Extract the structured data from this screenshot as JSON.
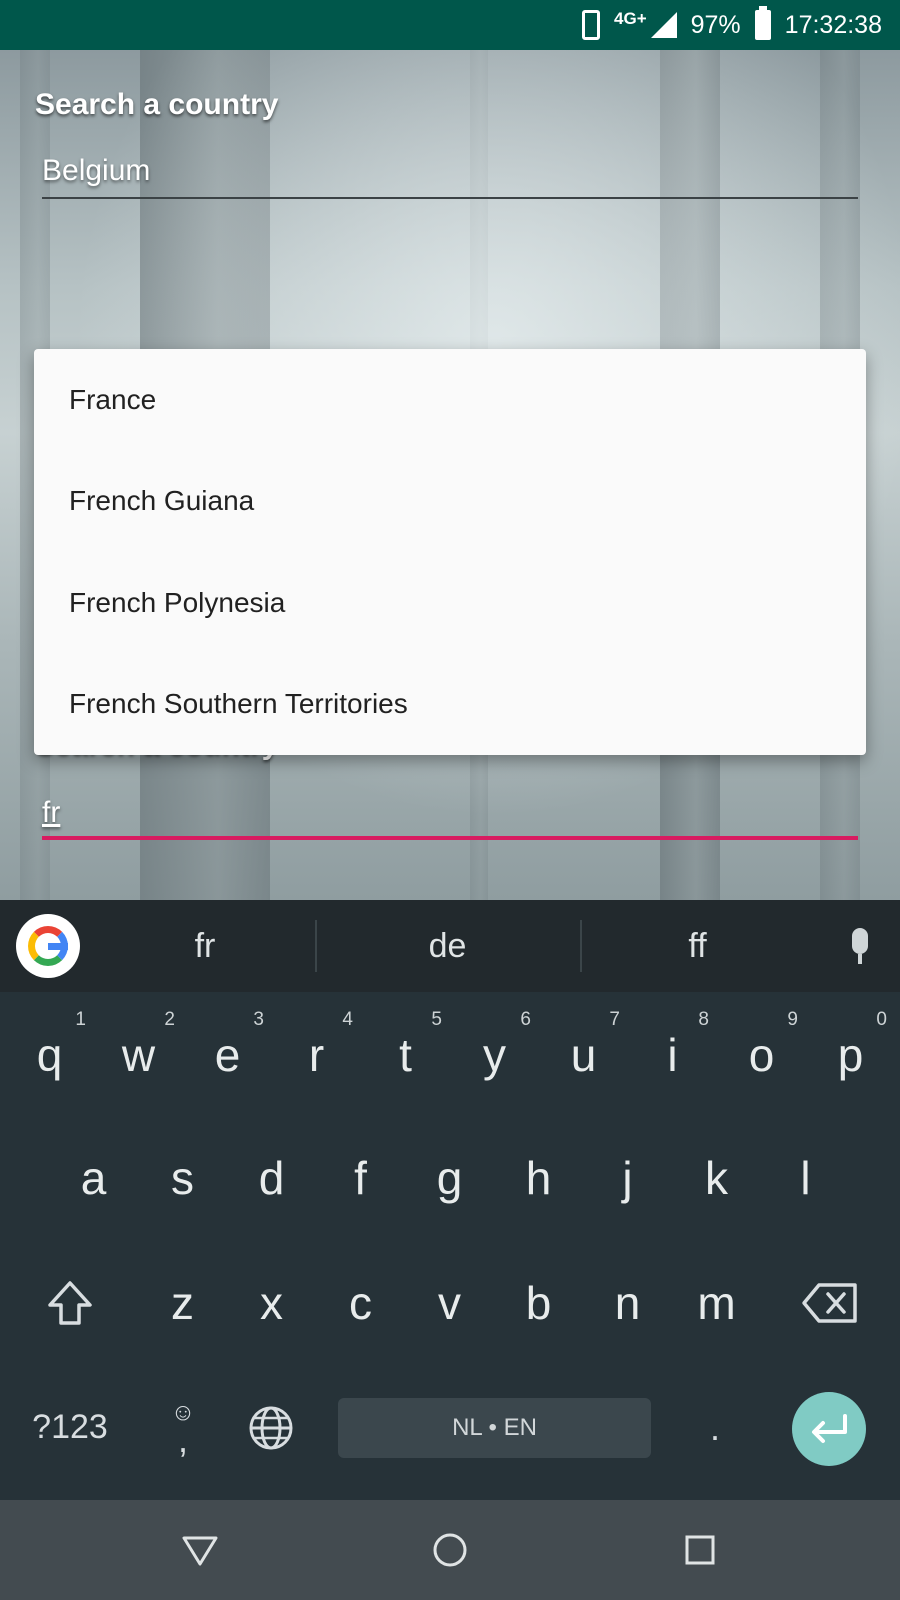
{
  "status_bar": {
    "network": "4G+",
    "battery": "97%",
    "time": "17:32:38",
    "icons": [
      "phone-orientation-icon",
      "signal-icon",
      "battery-icon"
    ]
  },
  "form": {
    "field1": {
      "label": "Search a country",
      "value": "Belgium"
    },
    "field2": {
      "label": "Search a country",
      "value": "fr"
    }
  },
  "dropdown": {
    "items": [
      "France",
      "French Guiana",
      "French Polynesia",
      "French Southern Territories"
    ]
  },
  "keyboard": {
    "suggestions": [
      "fr",
      "de",
      "ff"
    ],
    "row1": [
      {
        "key": "q",
        "hint": "1"
      },
      {
        "key": "w",
        "hint": "2"
      },
      {
        "key": "e",
        "hint": "3"
      },
      {
        "key": "r",
        "hint": "4"
      },
      {
        "key": "t",
        "hint": "5"
      },
      {
        "key": "y",
        "hint": "6"
      },
      {
        "key": "u",
        "hint": "7"
      },
      {
        "key": "i",
        "hint": "8"
      },
      {
        "key": "o",
        "hint": "9"
      },
      {
        "key": "p",
        "hint": "0"
      }
    ],
    "row2": [
      "a",
      "s",
      "d",
      "f",
      "g",
      "h",
      "j",
      "k",
      "l"
    ],
    "row3": [
      "z",
      "x",
      "c",
      "v",
      "b",
      "n",
      "m"
    ],
    "symbols_label": "?123",
    "comma_label": ",",
    "period_label": ".",
    "space_label": "NL • EN",
    "accent_color": "#80cbc4"
  },
  "colors": {
    "status_bar": "#00574b",
    "field_active_underline": "#d81b60",
    "keyboard_bg": "#263238"
  }
}
